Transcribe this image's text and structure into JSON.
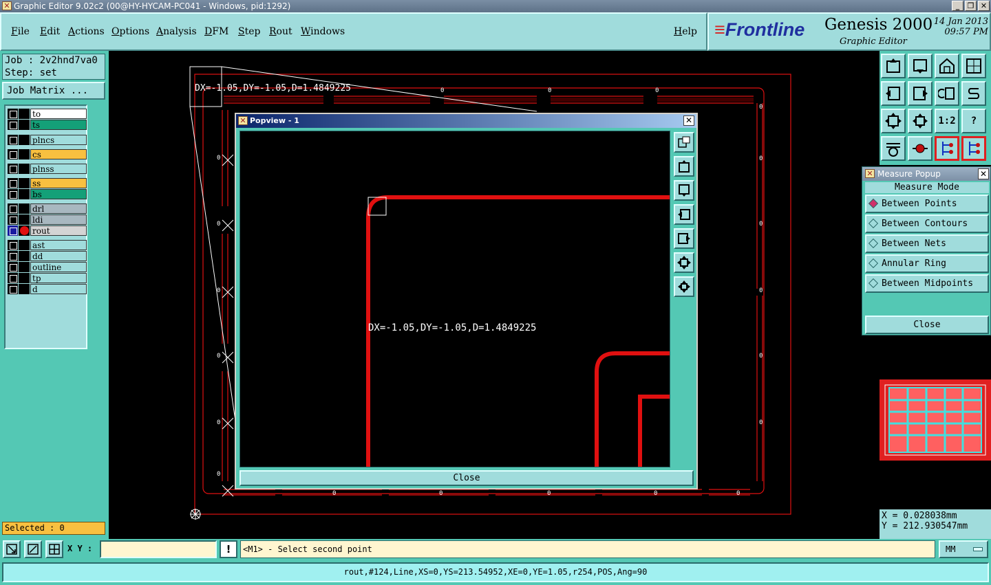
{
  "window": {
    "title": "Graphic Editor 9.02c2 (00@HY-HYCAM-PC041 - Windows, pid:1292)",
    "app_icon": "x-icon"
  },
  "menubar": {
    "items": [
      "File",
      "Edit",
      "Actions",
      "Options",
      "Analysis",
      "DFM",
      "Step",
      "Rout",
      "Windows"
    ],
    "help": "Help"
  },
  "brand": {
    "logo": "Frontline",
    "product": "Genesis 2000",
    "subtitle": "Graphic Editor",
    "date": "14 Jan 2013",
    "time": "09:57 PM"
  },
  "job": {
    "job_line": "Job : 2v2hnd7va0",
    "step_line": "Step: set",
    "matrix_button": "Job Matrix ..."
  },
  "layers": [
    {
      "name": "to",
      "color": "#ffffff"
    },
    {
      "name": "ts",
      "color": "#14a078"
    },
    {
      "name": "plncs",
      "color": "#a0dcdc"
    },
    {
      "name": "cs",
      "color": "#f8c040"
    },
    {
      "name": "plnss",
      "color": "#a0dcdc"
    },
    {
      "name": "ss",
      "color": "#f8c040"
    },
    {
      "name": "bs",
      "color": "#14a078"
    },
    {
      "name": "drl",
      "color": "#a8b8c0"
    },
    {
      "name": "ldi",
      "color": "#a8b8c0"
    },
    {
      "name": "rout",
      "color": "#d4d4d4",
      "active": true
    },
    {
      "name": "ast",
      "color": "#a0dcdc"
    },
    {
      "name": "dd",
      "color": "#a0dcdc"
    },
    {
      "name": "outline",
      "color": "#a0dcdc"
    },
    {
      "name": "tp",
      "color": "#a0dcdc"
    },
    {
      "name": "d",
      "color": "#a0dcdc"
    }
  ],
  "selected_label": "Selected : 0",
  "canvas": {
    "measure_text": "DX=-1.05,DY=-1.05,D=1.4849225"
  },
  "popview": {
    "title": "Popview - 1",
    "measure_text": "DX=-1.05,DY=-1.05,D=1.4849225",
    "close_label": "Close",
    "close_icon": "close-x-icon"
  },
  "measure_popup": {
    "title": "Measure Popup",
    "mode_heading": "Measure Mode",
    "options": [
      {
        "label": "Between Points",
        "selected": true
      },
      {
        "label": "Between Contours",
        "selected": false
      },
      {
        "label": "Between Nets",
        "selected": false
      },
      {
        "label": "Annular Ring",
        "selected": false
      },
      {
        "label": "Between Midpoints",
        "selected": false
      }
    ],
    "close_label": "Close"
  },
  "toolbar": {
    "one_to_two": "1:2",
    "help": "?"
  },
  "coords": {
    "x": "X  = 0.028038mm",
    "y": "Y  = 212.930547mm"
  },
  "command": {
    "xy_label": "X Y :",
    "xy_value": "",
    "prompt": "<M1> - Select second point",
    "units": "MM"
  },
  "status": {
    "text": "rout,#124,Line,XS=0,YS=213.54952,XE=0,YE=1.05,r254,POS,Ang=90"
  },
  "colors": {
    "panel": "#54c8b4",
    "button": "#a0dcdc",
    "rout": "#e01010",
    "highlight": "#f8c040"
  }
}
